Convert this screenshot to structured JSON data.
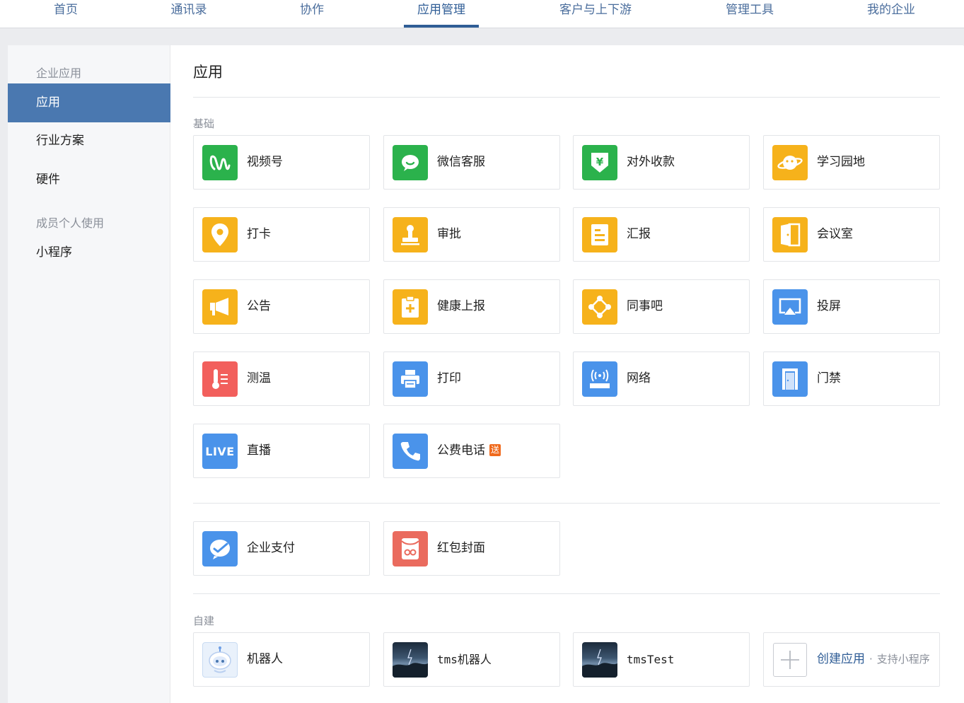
{
  "topnav": {
    "tabs": [
      {
        "label": "首页"
      },
      {
        "label": "通讯录"
      },
      {
        "label": "协作"
      },
      {
        "label": "应用管理",
        "active": true
      },
      {
        "label": "客户与上下游"
      },
      {
        "label": "管理工具"
      },
      {
        "label": "我的企业"
      }
    ]
  },
  "sidebar": {
    "group_enterprise": "企业应用",
    "items": [
      {
        "label": "应用",
        "active": true
      },
      {
        "label": "行业方案"
      },
      {
        "label": "硬件"
      }
    ],
    "group_personal": "成员个人使用",
    "personal_items": [
      {
        "label": "小程序"
      }
    ]
  },
  "content": {
    "title": "应用",
    "basic_label": "基础",
    "basic_apps": [
      {
        "name": "视频号",
        "icon": "channels-icon",
        "color": "#2bb24c"
      },
      {
        "name": "微信客服",
        "icon": "chat-bubble-icon",
        "color": "#2bb24c"
      },
      {
        "name": "对外收款",
        "icon": "yuan-shield-icon",
        "color": "#2bb24c"
      },
      {
        "name": "学习园地",
        "icon": "planet-icon",
        "color": "#f6b21b"
      },
      {
        "name": "打卡",
        "icon": "location-pin-icon",
        "color": "#f6b21b"
      },
      {
        "name": "审批",
        "icon": "stamp-icon",
        "color": "#f6b21b"
      },
      {
        "name": "汇报",
        "icon": "report-doc-icon",
        "color": "#f6b21b"
      },
      {
        "name": "会议室",
        "icon": "door-open-icon",
        "color": "#f6b21b"
      },
      {
        "name": "公告",
        "icon": "megaphone-icon",
        "color": "#f6b21b"
      },
      {
        "name": "健康上报",
        "icon": "medical-clipboard-icon",
        "color": "#f6b21b"
      },
      {
        "name": "同事吧",
        "icon": "network-nodes-icon",
        "color": "#f6b21b"
      },
      {
        "name": "投屏",
        "icon": "screen-cast-icon",
        "color": "#4a93ea"
      },
      {
        "name": "测温",
        "icon": "thermometer-icon",
        "color": "#f25f5c"
      },
      {
        "name": "打印",
        "icon": "printer-icon",
        "color": "#4a93ea"
      },
      {
        "name": "网络",
        "icon": "router-icon",
        "color": "#4a93ea"
      },
      {
        "name": "门禁",
        "icon": "door-icon",
        "color": "#4a93ea"
      },
      {
        "name": "直播",
        "icon": "live-icon",
        "icon_text": "LIVE",
        "color": "#4a93ea"
      },
      {
        "name": "公费电话",
        "icon": "phone-icon",
        "color": "#4a93ea",
        "badge": "送"
      }
    ],
    "extra_apps": [
      {
        "name": "企业支付",
        "icon": "payment-icon",
        "color": "#4a93ea"
      },
      {
        "name": "红包封面",
        "icon": "red-envelope-icon",
        "color": "#ea6b5e"
      }
    ],
    "custom_label": "自建",
    "custom_apps": [
      {
        "name": "机器人",
        "icon": "robot-icon"
      },
      {
        "name": "tms机器人",
        "icon": "storm-image-icon"
      },
      {
        "name": "tmsTest",
        "icon": "storm-image-icon"
      }
    ],
    "create": {
      "label": "创建应用",
      "separator": "·",
      "note": "支持小程序"
    }
  }
}
